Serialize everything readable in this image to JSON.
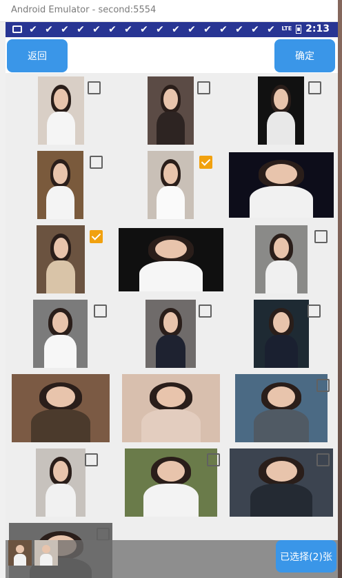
{
  "window": {
    "title": "Android Emulator - second:5554"
  },
  "status_bar": {
    "network": "LTE",
    "time": "2:13",
    "notification_count": 16
  },
  "toolbar": {
    "back_label": "返回",
    "confirm_label": "确定"
  },
  "photos": [
    {
      "selected": false
    },
    {
      "selected": false
    },
    {
      "selected": false
    },
    {
      "selected": false
    },
    {
      "selected": true
    },
    {
      "selected": false
    },
    {
      "selected": true
    },
    {
      "selected": false
    },
    {
      "selected": false
    },
    {
      "selected": false
    },
    {
      "selected": false
    },
    {
      "selected": false
    },
    {
      "selected": false
    },
    {
      "selected": false
    },
    {
      "selected": false
    },
    {
      "selected": false
    },
    {
      "selected": false
    },
    {
      "selected": false
    },
    {
      "selected": false
    }
  ],
  "selection": {
    "count_label": "已选择(2)张",
    "count": 2
  },
  "colors": {
    "accent": "#3a96e8",
    "status_bar": "#283593",
    "checked": "#f1a10f"
  }
}
